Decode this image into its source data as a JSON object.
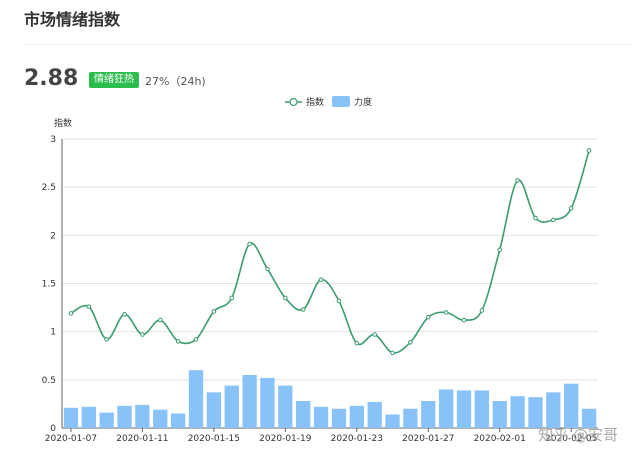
{
  "header": {
    "title": "市场情绪指数"
  },
  "summary": {
    "value": "2.88",
    "badge": "情绪狂热",
    "change": "27%（24h)"
  },
  "watermark": "知乎 @安哥",
  "colors": {
    "line": "#3a9c6e",
    "bar": "#88c2f8",
    "badge": "#2dbd4e"
  },
  "chart_data": {
    "type": "bar+line",
    "ylabel": "指数",
    "ylim": [
      0,
      3
    ],
    "yticks": [
      "0",
      "0.5",
      "1",
      "1.5",
      "2",
      "2.5",
      "3"
    ],
    "xtick_labels": [
      "2020-01-07",
      "2020-01-11",
      "2020-01-15",
      "2020-01-19",
      "2020-01-23",
      "2020-01-27",
      "2020-02-01",
      "2020-02-05"
    ],
    "legend": [
      "指数",
      "力度"
    ],
    "legend_position": "top-center",
    "grid": true,
    "series": [
      {
        "name": "指数",
        "type": "line",
        "values": [
          1.19,
          1.26,
          0.92,
          1.18,
          0.97,
          1.12,
          0.9,
          0.92,
          1.21,
          1.35,
          1.91,
          1.65,
          1.35,
          1.23,
          1.54,
          1.32,
          0.88,
          0.97,
          0.78,
          0.89,
          1.15,
          1.2,
          1.12,
          1.22,
          1.85,
          2.57,
          2.18,
          2.16,
          2.28,
          2.88
        ]
      },
      {
        "name": "力度",
        "type": "bar",
        "values": [
          0.21,
          0.22,
          0.16,
          0.23,
          0.24,
          0.19,
          0.15,
          0.6,
          0.37,
          0.44,
          0.55,
          0.52,
          0.44,
          0.28,
          0.22,
          0.2,
          0.23,
          0.27,
          0.14,
          0.2,
          0.28,
          0.4,
          0.39,
          0.39,
          0.28,
          0.33,
          0.32,
          0.37,
          0.46,
          0.2
        ]
      }
    ]
  }
}
